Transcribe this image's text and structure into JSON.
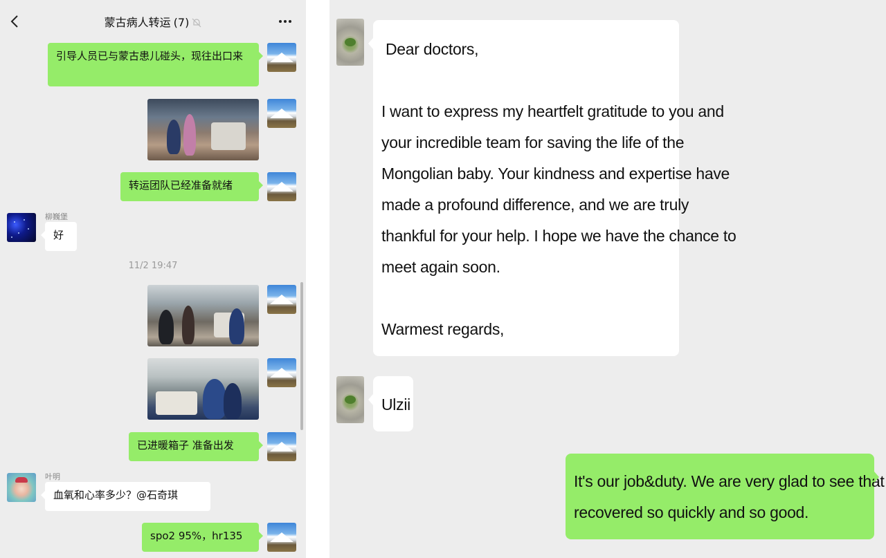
{
  "left_chat": {
    "title": "蒙古病人转运",
    "member_count": "(7)",
    "messages": [
      {
        "text": "引导人员已与蒙古患儿碰头，现往出口来"
      },
      {
        "text": "转运团队已经准备就绪"
      },
      {
        "sender": "柳巍堡",
        "text": "好"
      },
      {
        "timestamp": "11/2 19:47"
      },
      {
        "text": "已进暖箱子 准备出发"
      },
      {
        "sender": "叶明",
        "text": "血氧和心率多少？@石奇琪"
      },
      {
        "text": "spo2 95%，hr135"
      }
    ]
  },
  "right_chat": {
    "letter": {
      "greeting": "Dear doctors,",
      "body_lines": [
        "I want to express my heartfelt gratitude to you and",
        "your incredible team for saving the life of the",
        "Mongolian baby. Your kindness and expertise have",
        "made a profound difference, and we are truly",
        "thankful for your help. I hope we have the chance to",
        "meet again soon."
      ],
      "closing": "Warmest regards,"
    },
    "signature": "Ulzii",
    "reply_lines": [
      "It's our job&duty. We are very glad to see that Jargal",
      "recovered so quickly and so good."
    ]
  },
  "colors": {
    "sent_bubble": "#95ec69",
    "received_bubble": "#ffffff",
    "chat_background": "#ededed"
  }
}
